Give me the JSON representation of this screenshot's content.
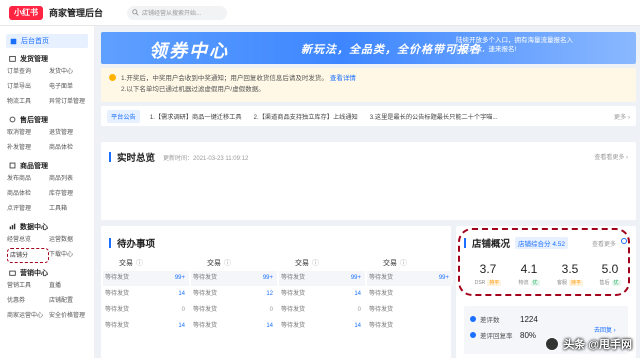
{
  "header": {
    "logo": "小红书",
    "title": "商家管理后台",
    "search_placeholder": "店铺经营从搜索开始..."
  },
  "sidebar": {
    "home": "后台首页",
    "groups": [
      {
        "title": "发货管理",
        "items": [
          "订单查询",
          "发货中心",
          "订单导出",
          "电子面单",
          "物流工具",
          "异常订单管理"
        ]
      },
      {
        "title": "售后管理",
        "items": [
          "取消管理",
          "退货管理",
          "补发管理",
          "商品体检"
        ]
      },
      {
        "title": "商品管理",
        "items": [
          "发布商品",
          "商品列表",
          "商品体检",
          "库存管理",
          "点评管理",
          "工具箱"
        ]
      },
      {
        "title": "数据中心",
        "items": [
          "经营总览",
          "运营数据",
          "店铺分",
          "下载中心"
        ]
      },
      {
        "title": "营销中心",
        "items": [
          "营销工具",
          "直播",
          "优惠券",
          "店铺配置",
          "商家运营中心",
          "安全价格管理"
        ]
      }
    ]
  },
  "banner": {
    "title": "领券中心",
    "subtitle": "新玩法，全品类，全价格带可报名",
    "right_text": "陆续开放多个入口，拥有海量流量报名入口已开放，速来报名!"
  },
  "notice": {
    "line1": "1.开奖后，中奖用户会收到中奖通知；用户回复收货信息后请及时发货。",
    "link": "查看详情",
    "line2": "2.以下名单均已通过机器过滤虚假用户/虚假数据。"
  },
  "announce": {
    "tag": "平台公告",
    "items": [
      "1.【需求调研】商品一键迁移工具",
      "2.【渠道商品支持独立库存】上线通知",
      "3.这里是最长的公告标题最长只能二十个字喵..."
    ],
    "more": "更多 ›"
  },
  "realtime": {
    "title": "实时总览",
    "updated": "更新时间：2021-03-23  11:09:12",
    "more": "查看看更多 ›"
  },
  "todo": {
    "title": "待办事项",
    "columns": [
      {
        "header": "交易",
        "rows": [
          [
            "等待发货",
            "99+"
          ],
          [
            "等待发货",
            "14"
          ],
          [
            "等待发货",
            "0"
          ],
          [
            "等待发货",
            "14"
          ]
        ]
      },
      {
        "header": "交易",
        "rows": [
          [
            "等待发货",
            "99+"
          ],
          [
            "等待发货",
            "12"
          ],
          [
            "等待发货",
            "0"
          ],
          [
            "等待发货",
            "14"
          ]
        ]
      },
      {
        "header": "交易",
        "rows": [
          [
            "等待发货",
            "99+"
          ],
          [
            "等待发货",
            "14"
          ],
          [
            "等待发货",
            "0"
          ],
          [
            "等待发货",
            "14"
          ]
        ]
      },
      {
        "header": "交易",
        "rows": [
          [
            "等待发货",
            "99+"
          ],
          [
            "等待发货",
            ""
          ],
          [
            "等待发货",
            ""
          ],
          [
            "等待发货",
            ""
          ]
        ]
      }
    ]
  },
  "shop": {
    "title": "店铺概况",
    "score_label": "店铺综合分 4.52",
    "more": "查看更多",
    "metrics": [
      {
        "value": "3.7",
        "label": "DSR",
        "trend": "持平"
      },
      {
        "value": "4.1",
        "label": "物流",
        "trend": "优"
      },
      {
        "value": "3.5",
        "label": "客服",
        "trend": "持平"
      },
      {
        "value": "5.0",
        "label": "售后",
        "trend": "优"
      }
    ],
    "eval": [
      {
        "label": "差评数",
        "value": "1224"
      },
      {
        "label": "差评回复率",
        "value": "80%"
      }
    ],
    "eval_link": "去回复 ›"
  },
  "watermark": "头条 @甩手网"
}
